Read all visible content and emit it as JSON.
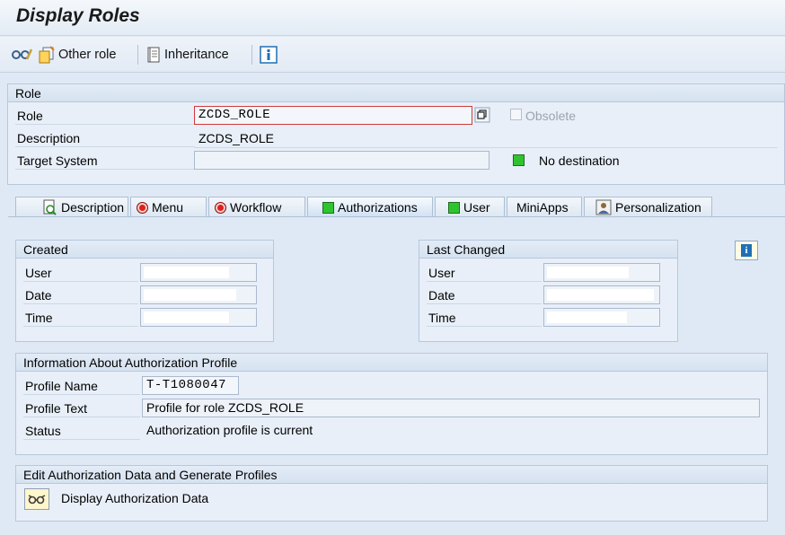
{
  "window": {
    "title": "Display Roles"
  },
  "toolbar": {
    "other_role_label": "Other role",
    "inheritance_label": "Inheritance",
    "icons": [
      "glasses-icon",
      "other-role-icon",
      "inheritance-icon",
      "info-icon"
    ]
  },
  "role_group": {
    "heading": "Role",
    "role_label": "Role",
    "role_value": "ZCDS_ROLE",
    "obsolete_label": "Obsolete",
    "obsolete_checked": false,
    "description_label": "Description",
    "description_value": "ZCDS_ROLE",
    "target_system_label": "Target System",
    "target_system_value": "",
    "destination_status": "No destination"
  },
  "tabs": [
    {
      "label": "Description",
      "status": "document-icon"
    },
    {
      "label": "Menu",
      "status": "red"
    },
    {
      "label": "Workflow",
      "status": "red"
    },
    {
      "label": "Authorizations",
      "status": "green",
      "active": true
    },
    {
      "label": "User",
      "status": "green"
    },
    {
      "label": "MiniApps",
      "status": "none"
    },
    {
      "label": "Personalization",
      "status": "person-icon"
    }
  ],
  "created": {
    "heading": "Created",
    "user_label": "User",
    "date_label": "Date",
    "time_label": "Time"
  },
  "last_changed": {
    "heading": "Last Changed",
    "user_label": "User",
    "date_label": "Date",
    "time_label": "Time"
  },
  "profile_info": {
    "heading": "Information About Authorization Profile",
    "profile_name_label": "Profile Name",
    "profile_name_value": "T-T1080047",
    "profile_text_label": "Profile Text",
    "profile_text_value": "Profile for role ZCDS_ROLE",
    "status_label": "Status",
    "status_value": "Authorization profile is current"
  },
  "edit_auth": {
    "heading": "Edit Authorization Data and Generate Profiles",
    "display_label": "Display Authorization Data"
  },
  "colors": {
    "status_green": "#2fc42f",
    "status_red": "#e0201a",
    "field_error_border": "#d23a3a"
  }
}
